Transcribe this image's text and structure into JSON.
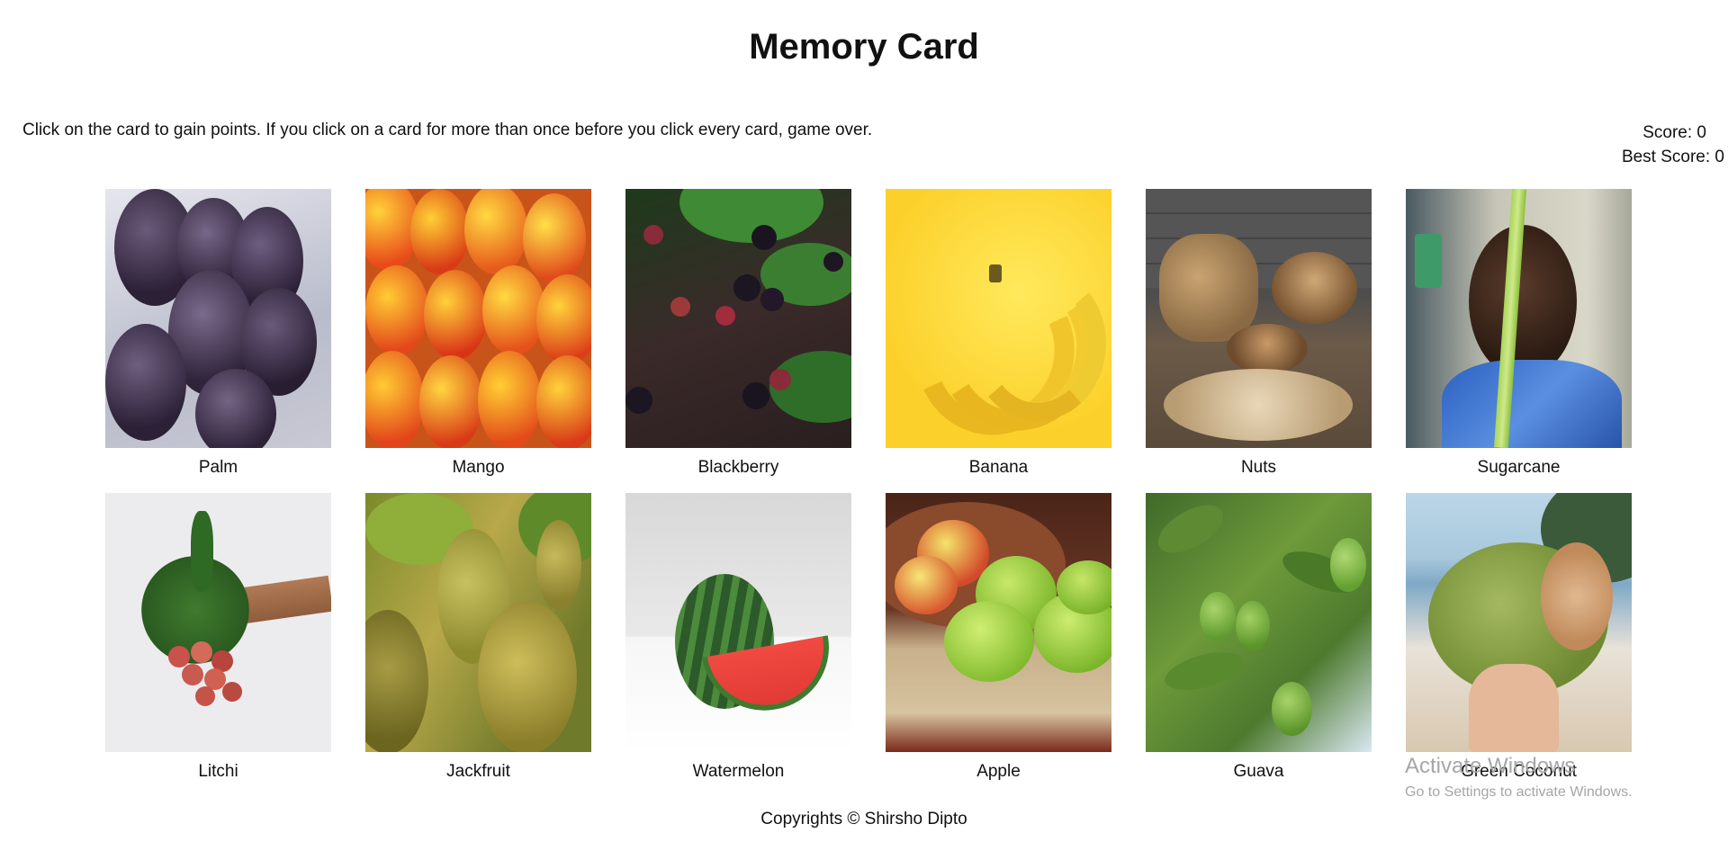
{
  "title": "Memory Card",
  "instructions": "Click on the card to gain points. If you click on a card for more than once before you click every card, game over.",
  "score_text": "Score: 0",
  "best_score_text": "Best Score: 0",
  "cards": [
    {
      "label": "Palm"
    },
    {
      "label": "Mango"
    },
    {
      "label": "Blackberry"
    },
    {
      "label": "Banana"
    },
    {
      "label": "Nuts"
    },
    {
      "label": "Sugarcane"
    },
    {
      "label": "Litchi"
    },
    {
      "label": "Jackfruit"
    },
    {
      "label": "Watermelon"
    },
    {
      "label": "Apple"
    },
    {
      "label": "Guava"
    },
    {
      "label": "Green Coconut"
    }
  ],
  "footer": "Copyrights © Shirsho Dipto",
  "watermark": {
    "title": "Activate Windows",
    "subtitle": "Go to Settings to activate Windows."
  }
}
